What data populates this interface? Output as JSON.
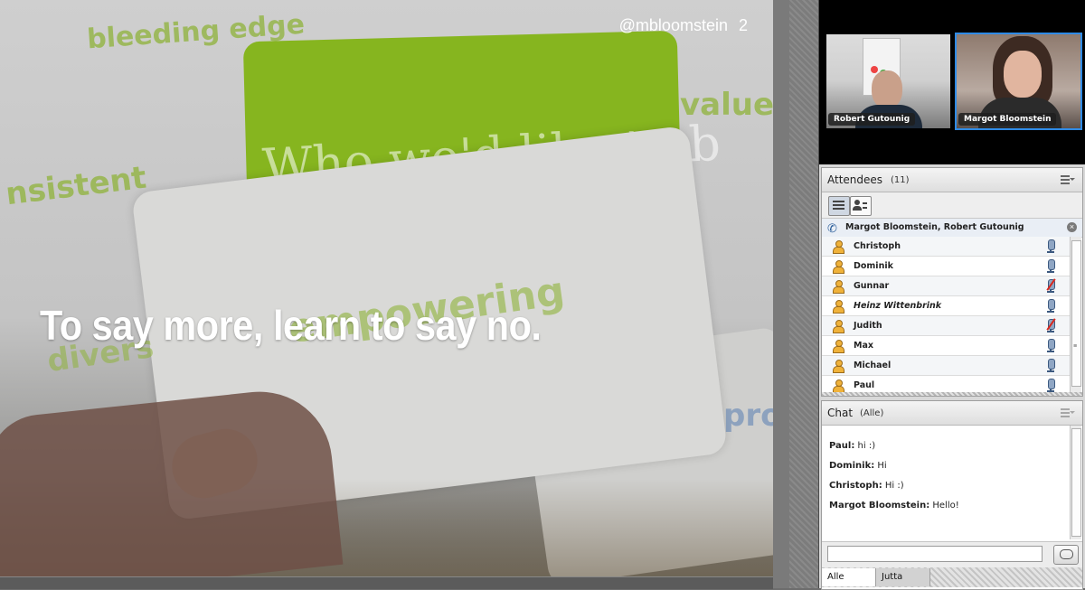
{
  "slide": {
    "handle": "@mbloomstein",
    "page": "2",
    "headline": "To say more, learn to say no.",
    "background_words": [
      "bleeding edge",
      "value",
      "nsistent",
      "Who we'd like to b",
      "empowering",
      "divers",
      "pro"
    ]
  },
  "cameras": [
    {
      "name": "Robert Gutounig",
      "active": false
    },
    {
      "name": "Margot Bloomstein",
      "active": true
    }
  ],
  "attendees": {
    "title": "Attendees",
    "count": "(11)",
    "speakers": "Margot Bloomstein, Robert Gutounig",
    "list": [
      {
        "name": "Christoph",
        "italic": false,
        "muted": false
      },
      {
        "name": "Dominik",
        "italic": false,
        "muted": false
      },
      {
        "name": "Gunnar",
        "italic": false,
        "muted": true
      },
      {
        "name": "Heinz Wittenbrink",
        "italic": true,
        "muted": false
      },
      {
        "name": "Judith",
        "italic": false,
        "muted": true
      },
      {
        "name": "Max",
        "italic": false,
        "muted": false
      },
      {
        "name": "Michael",
        "italic": false,
        "muted": false
      },
      {
        "name": "Paul",
        "italic": false,
        "muted": false
      }
    ]
  },
  "chat": {
    "title": "Chat",
    "scope": "(Alle)",
    "messages": [
      {
        "author": "Paul:",
        "text": " hi :)"
      },
      {
        "author": "Dominik:",
        "text": " Hi"
      },
      {
        "author": "Christoph:",
        "text": " Hi :)"
      },
      {
        "author": "Margot Bloomstein:",
        "text": " Hello!"
      }
    ],
    "input_value": "",
    "tabs": [
      "Alle",
      "Jutta"
    ]
  },
  "colors": {
    "accent": "#2f8be6",
    "slide_green": "#86b51f",
    "muted_red": "#d9261c"
  }
}
